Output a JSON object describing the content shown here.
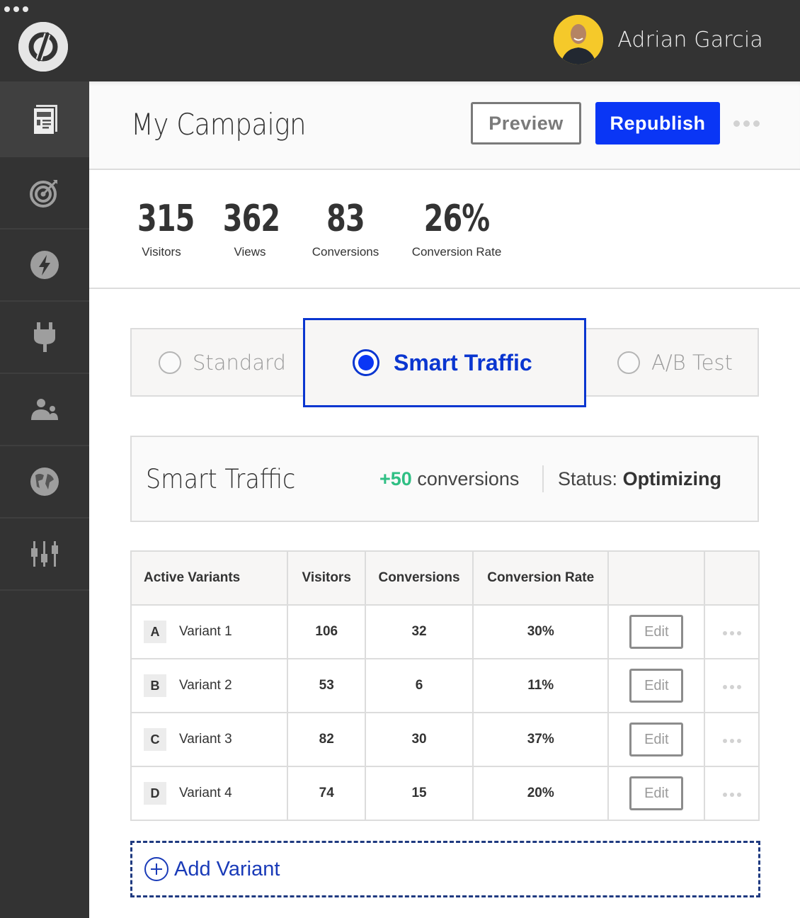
{
  "app": {
    "user_name": "Adrian Garcia"
  },
  "sidebar": {
    "items": [
      {
        "icon": "pages-icon",
        "active": true
      },
      {
        "icon": "target-icon",
        "active": false
      },
      {
        "icon": "lightning-icon",
        "active": false
      },
      {
        "icon": "plug-icon",
        "active": false
      },
      {
        "icon": "users-icon",
        "active": false
      },
      {
        "icon": "globe-icon",
        "active": false
      },
      {
        "icon": "sliders-icon",
        "active": false
      }
    ]
  },
  "header": {
    "title": "My Campaign",
    "preview_label": "Preview",
    "republish_label": "Republish",
    "colors": {
      "primary": "#0a36f5"
    }
  },
  "stats": [
    {
      "value": "315",
      "label": "Visitors"
    },
    {
      "value": "362",
      "label": "Views"
    },
    {
      "value": "83",
      "label": "Conversions"
    },
    {
      "value": "26%",
      "label": "Conversion Rate"
    }
  ],
  "modes": {
    "selected": "Smart Traffic",
    "options": [
      {
        "label": "Standard"
      },
      {
        "label": "Smart Traffic"
      },
      {
        "label": "A/B Test"
      }
    ]
  },
  "smart_traffic": {
    "title": "Smart Traffic",
    "conversions_delta": "+50",
    "conversions_suffix": "conversions",
    "status_label": "Status:",
    "status_value": "Optimizing",
    "colors": {
      "positive": "#2fbf84"
    }
  },
  "variants_table": {
    "headers": [
      "Active Variants",
      "Visitors",
      "Conversions",
      "Conversion Rate",
      "",
      ""
    ],
    "rows": [
      {
        "letter": "A",
        "name": "Variant 1",
        "visitors": "106",
        "conversions": "32",
        "rate": "30%",
        "edit_label": "Edit"
      },
      {
        "letter": "B",
        "name": "Variant 2",
        "visitors": "53",
        "conversions": "6",
        "rate": "11%",
        "edit_label": "Edit"
      },
      {
        "letter": "C",
        "name": "Variant 3",
        "visitors": "82",
        "conversions": "30",
        "rate": "37%",
        "edit_label": "Edit"
      },
      {
        "letter": "D",
        "name": "Variant 4",
        "visitors": "74",
        "conversions": "15",
        "rate": "20%",
        "edit_label": "Edit"
      }
    ]
  },
  "add_variant": {
    "label": "Add Variant"
  }
}
